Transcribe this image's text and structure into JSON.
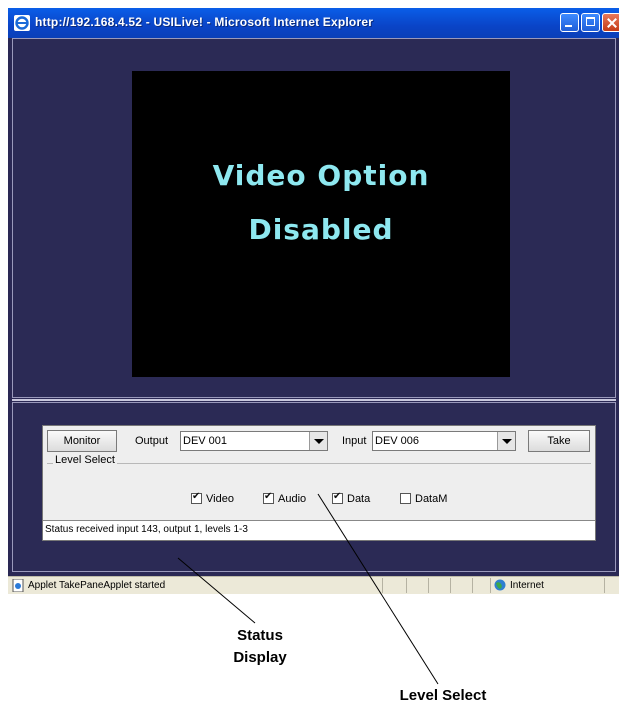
{
  "window": {
    "title": "http://192.168.4.52 - USILive! - Microsoft Internet Explorer"
  },
  "video": {
    "line1": "Video Option",
    "line2": "Disabled",
    "text_color": "#8ee8f0"
  },
  "applet": {
    "monitor_label": "Monitor",
    "output_label": "Output",
    "output_value": "DEV 001",
    "input_label": "Input",
    "input_value": "DEV 006",
    "take_label": "Take",
    "level_select_title": "Level Select",
    "levels": [
      {
        "label": "Video",
        "checked": true
      },
      {
        "label": "Audio",
        "checked": true
      },
      {
        "label": "Data",
        "checked": true
      },
      {
        "label": "DataM",
        "checked": false
      }
    ],
    "status_text": "Status received  input 143, output 1, levels 1-3"
  },
  "statusbar": {
    "message": "Applet TakePaneApplet started",
    "zone": "Internet"
  },
  "callouts": {
    "status_display_line1": "Status",
    "status_display_line2": "Display",
    "level_select": "Level Select"
  },
  "colors": {
    "background": "#2b2a55",
    "titlebar": "#0a44c7"
  }
}
